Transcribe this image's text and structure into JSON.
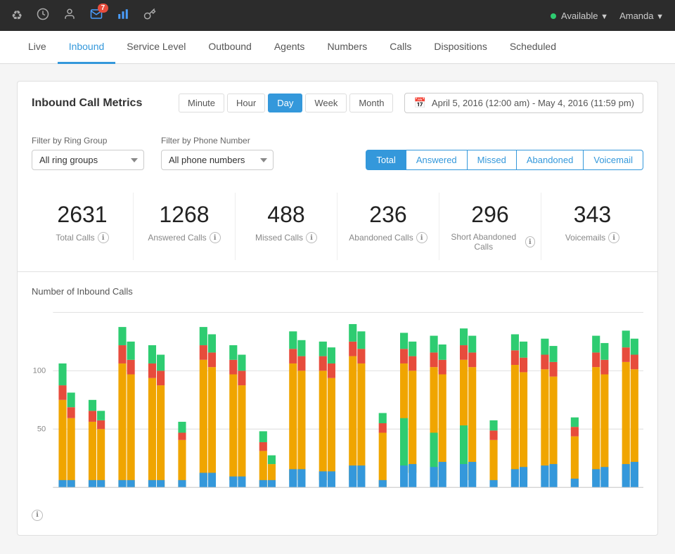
{
  "topbar": {
    "icons": [
      {
        "name": "recycle-icon",
        "symbol": "♻",
        "active": false
      },
      {
        "name": "clock-icon",
        "symbol": "⏱",
        "active": false
      },
      {
        "name": "user-icon",
        "symbol": "👤",
        "active": false
      },
      {
        "name": "mail-icon",
        "symbol": "✉",
        "active": true,
        "badge": "7"
      },
      {
        "name": "chart-icon",
        "symbol": "📊",
        "active": true
      },
      {
        "name": "key-icon",
        "symbol": "🔑",
        "active": false
      }
    ],
    "status": "Available",
    "user": "Amanda"
  },
  "tabs": [
    {
      "label": "Live",
      "active": false
    },
    {
      "label": "Inbound",
      "active": true
    },
    {
      "label": "Service Level",
      "active": false
    },
    {
      "label": "Outbound",
      "active": false
    },
    {
      "label": "Agents",
      "active": false
    },
    {
      "label": "Numbers",
      "active": false
    },
    {
      "label": "Calls",
      "active": false
    },
    {
      "label": "Dispositions",
      "active": false
    },
    {
      "label": "Scheduled",
      "active": false
    }
  ],
  "metrics": {
    "title": "Inbound Call Metrics",
    "time_buttons": [
      {
        "label": "Minute",
        "active": false
      },
      {
        "label": "Hour",
        "active": false
      },
      {
        "label": "Day",
        "active": true
      },
      {
        "label": "Week",
        "active": false
      },
      {
        "label": "Month",
        "active": false
      }
    ],
    "date_range": "April 5, 2016 (12:00 am) - May 4, 2016 (11:59 pm)"
  },
  "filters": {
    "ring_group_label": "Filter by Ring Group",
    "ring_group_value": "All ring groups",
    "phone_number_label": "Filter by Phone Number",
    "phone_number_value": "All phone numbers"
  },
  "view_buttons": [
    {
      "label": "Total",
      "active": true
    },
    {
      "label": "Answered",
      "active": false
    },
    {
      "label": "Missed",
      "active": false
    },
    {
      "label": "Abandoned",
      "active": false
    },
    {
      "label": "Voicemail",
      "active": false
    }
  ],
  "stats": [
    {
      "number": "2631",
      "label": "Total Calls"
    },
    {
      "number": "1268",
      "label": "Answered Calls"
    },
    {
      "number": "488",
      "label": "Missed Calls"
    },
    {
      "number": "236",
      "label": "Abandoned Calls"
    },
    {
      "number": "296",
      "label": "Short Abandoned Calls"
    },
    {
      "number": "343",
      "label": "Voicemails"
    }
  ],
  "chart": {
    "title": "Number of Inbound Calls",
    "y_labels": [
      "100",
      "50"
    ],
    "colors": {
      "answered": "#f0a500",
      "missed": "#e74c3c",
      "abandoned": "#2ecc71",
      "short_abandoned": "#3498db",
      "voicemail": "#95a5a6"
    }
  }
}
